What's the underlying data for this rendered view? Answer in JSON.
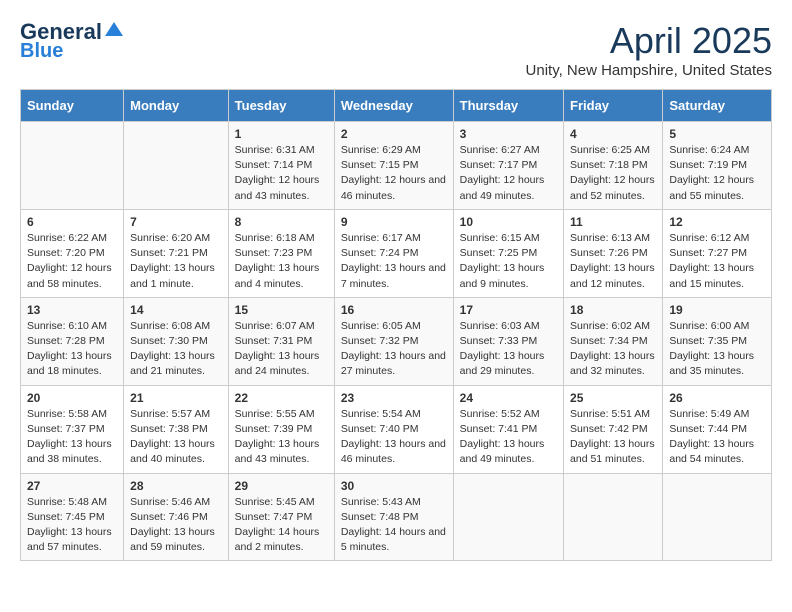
{
  "logo": {
    "line1": "General",
    "line2": "Blue"
  },
  "title": "April 2025",
  "subtitle": "Unity, New Hampshire, United States",
  "days_of_week": [
    "Sunday",
    "Monday",
    "Tuesday",
    "Wednesday",
    "Thursday",
    "Friday",
    "Saturday"
  ],
  "weeks": [
    [
      {
        "num": "",
        "info": ""
      },
      {
        "num": "",
        "info": ""
      },
      {
        "num": "1",
        "info": "Sunrise: 6:31 AM\nSunset: 7:14 PM\nDaylight: 12 hours and 43 minutes."
      },
      {
        "num": "2",
        "info": "Sunrise: 6:29 AM\nSunset: 7:15 PM\nDaylight: 12 hours and 46 minutes."
      },
      {
        "num": "3",
        "info": "Sunrise: 6:27 AM\nSunset: 7:17 PM\nDaylight: 12 hours and 49 minutes."
      },
      {
        "num": "4",
        "info": "Sunrise: 6:25 AM\nSunset: 7:18 PM\nDaylight: 12 hours and 52 minutes."
      },
      {
        "num": "5",
        "info": "Sunrise: 6:24 AM\nSunset: 7:19 PM\nDaylight: 12 hours and 55 minutes."
      }
    ],
    [
      {
        "num": "6",
        "info": "Sunrise: 6:22 AM\nSunset: 7:20 PM\nDaylight: 12 hours and 58 minutes."
      },
      {
        "num": "7",
        "info": "Sunrise: 6:20 AM\nSunset: 7:21 PM\nDaylight: 13 hours and 1 minute."
      },
      {
        "num": "8",
        "info": "Sunrise: 6:18 AM\nSunset: 7:23 PM\nDaylight: 13 hours and 4 minutes."
      },
      {
        "num": "9",
        "info": "Sunrise: 6:17 AM\nSunset: 7:24 PM\nDaylight: 13 hours and 7 minutes."
      },
      {
        "num": "10",
        "info": "Sunrise: 6:15 AM\nSunset: 7:25 PM\nDaylight: 13 hours and 9 minutes."
      },
      {
        "num": "11",
        "info": "Sunrise: 6:13 AM\nSunset: 7:26 PM\nDaylight: 13 hours and 12 minutes."
      },
      {
        "num": "12",
        "info": "Sunrise: 6:12 AM\nSunset: 7:27 PM\nDaylight: 13 hours and 15 minutes."
      }
    ],
    [
      {
        "num": "13",
        "info": "Sunrise: 6:10 AM\nSunset: 7:28 PM\nDaylight: 13 hours and 18 minutes."
      },
      {
        "num": "14",
        "info": "Sunrise: 6:08 AM\nSunset: 7:30 PM\nDaylight: 13 hours and 21 minutes."
      },
      {
        "num": "15",
        "info": "Sunrise: 6:07 AM\nSunset: 7:31 PM\nDaylight: 13 hours and 24 minutes."
      },
      {
        "num": "16",
        "info": "Sunrise: 6:05 AM\nSunset: 7:32 PM\nDaylight: 13 hours and 27 minutes."
      },
      {
        "num": "17",
        "info": "Sunrise: 6:03 AM\nSunset: 7:33 PM\nDaylight: 13 hours and 29 minutes."
      },
      {
        "num": "18",
        "info": "Sunrise: 6:02 AM\nSunset: 7:34 PM\nDaylight: 13 hours and 32 minutes."
      },
      {
        "num": "19",
        "info": "Sunrise: 6:00 AM\nSunset: 7:35 PM\nDaylight: 13 hours and 35 minutes."
      }
    ],
    [
      {
        "num": "20",
        "info": "Sunrise: 5:58 AM\nSunset: 7:37 PM\nDaylight: 13 hours and 38 minutes."
      },
      {
        "num": "21",
        "info": "Sunrise: 5:57 AM\nSunset: 7:38 PM\nDaylight: 13 hours and 40 minutes."
      },
      {
        "num": "22",
        "info": "Sunrise: 5:55 AM\nSunset: 7:39 PM\nDaylight: 13 hours and 43 minutes."
      },
      {
        "num": "23",
        "info": "Sunrise: 5:54 AM\nSunset: 7:40 PM\nDaylight: 13 hours and 46 minutes."
      },
      {
        "num": "24",
        "info": "Sunrise: 5:52 AM\nSunset: 7:41 PM\nDaylight: 13 hours and 49 minutes."
      },
      {
        "num": "25",
        "info": "Sunrise: 5:51 AM\nSunset: 7:42 PM\nDaylight: 13 hours and 51 minutes."
      },
      {
        "num": "26",
        "info": "Sunrise: 5:49 AM\nSunset: 7:44 PM\nDaylight: 13 hours and 54 minutes."
      }
    ],
    [
      {
        "num": "27",
        "info": "Sunrise: 5:48 AM\nSunset: 7:45 PM\nDaylight: 13 hours and 57 minutes."
      },
      {
        "num": "28",
        "info": "Sunrise: 5:46 AM\nSunset: 7:46 PM\nDaylight: 13 hours and 59 minutes."
      },
      {
        "num": "29",
        "info": "Sunrise: 5:45 AM\nSunset: 7:47 PM\nDaylight: 14 hours and 2 minutes."
      },
      {
        "num": "30",
        "info": "Sunrise: 5:43 AM\nSunset: 7:48 PM\nDaylight: 14 hours and 5 minutes."
      },
      {
        "num": "",
        "info": ""
      },
      {
        "num": "",
        "info": ""
      },
      {
        "num": "",
        "info": ""
      }
    ]
  ]
}
